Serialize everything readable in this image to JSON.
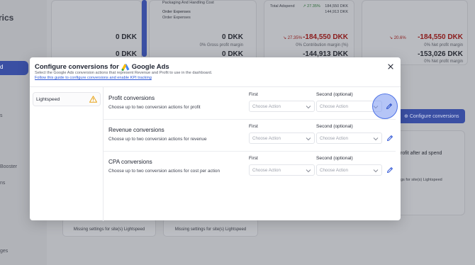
{
  "background": {
    "sidebar_title": "trics",
    "active_item": "d",
    "side_items": [
      "s",
      "Booster",
      "ns",
      "ges"
    ],
    "cards": [
      {
        "lines": [
          "Packaging And Handling Cost",
          "Order Expenses",
          "Order Expenses"
        ],
        "value": "0 DKK",
        "value2": "0 DKK",
        "sub": "0% Gross profit margin"
      },
      {
        "value": "0 DKK",
        "value2": "0 DKK"
      },
      {
        "adspend_label": "Total Adspend",
        "adspend_change": "27.35%",
        "adspend_value": "184,550 DKK",
        "adspend_value2": "144,913 DKK",
        "change": "27.35%",
        "value": "-184,550 DKK",
        "sub": "0% Contribution margin (%)",
        "value2": "-144,913 DKK"
      },
      {
        "change": "20.6%",
        "value": "-184,550 DKK",
        "sub": "0% Net profit margin",
        "value2": "-153,026 DKK",
        "sub2": "0% Net profit margin"
      }
    ],
    "configure_button": "Configure conversions",
    "panel_title": "rofit after ad spend",
    "panel_sub": "gs for site(s) Lightspeed",
    "bottom_cards": [
      "Missing settings for site(s) Lightspeed",
      "Missing settings for site(s) Lightspeed"
    ]
  },
  "modal": {
    "title": "Configure conversions for",
    "brand": "Google Ads",
    "description": "Select the Google Ads conversion actions that represent Revenue and Profit to use in the dashboard.",
    "guide_link": "Follow this guide to configure conversions and enable KPI tracking",
    "sites": [
      {
        "label": "Lightspeed",
        "status": "warning"
      }
    ],
    "rows": [
      {
        "title": "Profit conversions",
        "subtitle": "Choose up to two conversion actions for profit",
        "first_label": "First",
        "second_label": "Second (optional)",
        "first_value": "Choose Action",
        "second_value": "Choose Action"
      },
      {
        "title": "Revenue conversions",
        "subtitle": "Choose up to two conversion actions for revenue",
        "first_label": "First",
        "second_label": "Second (optional)",
        "first_value": "Choose Action",
        "second_value": "Choose Action"
      },
      {
        "title": "CPA conversions",
        "subtitle": "Choose up to two conversion actions for cost per action",
        "first_label": "First",
        "second_label": "Second (optional)",
        "first_value": "Choose Action",
        "second_value": "Choose Action"
      }
    ]
  },
  "colors": {
    "accent": "#2a55d6",
    "warning": "#e8a317",
    "edit_icon": "#3a5fd8"
  }
}
